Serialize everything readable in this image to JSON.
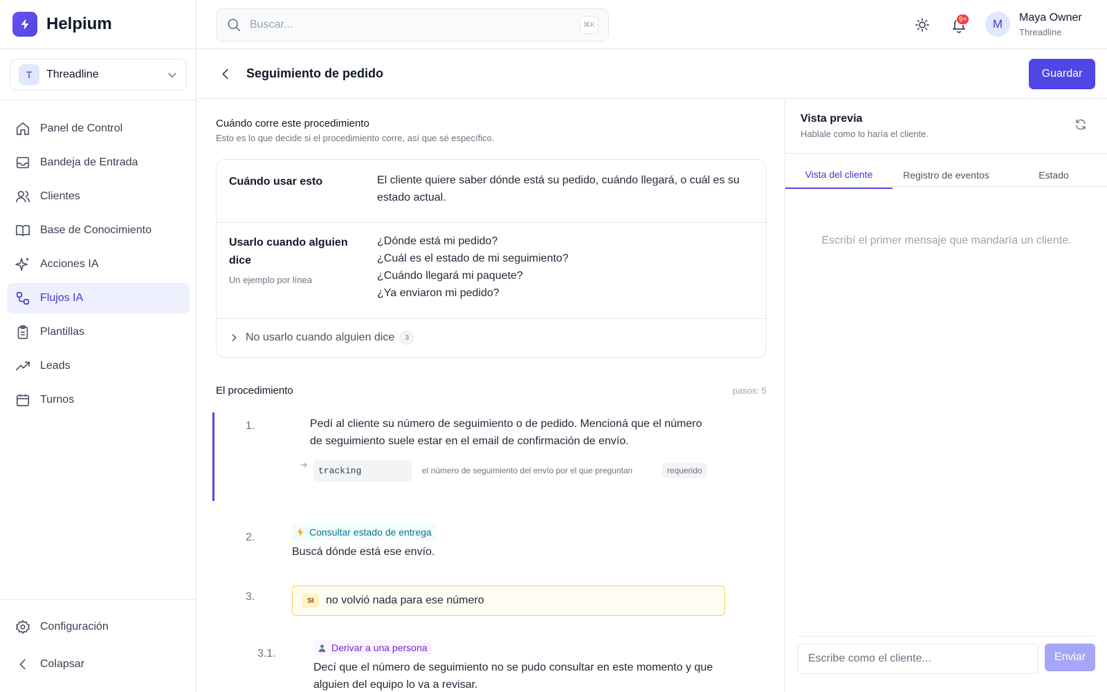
{
  "app": {
    "name": "Helpium",
    "logo_icon": "bolt-icon",
    "brand_color": "#4f46e5"
  },
  "workspace": {
    "initial": "T",
    "name": "Threadline"
  },
  "nav": {
    "items": [
      {
        "label": "Panel de Control",
        "icon": "home-icon"
      },
      {
        "label": "Bandeja de Entrada",
        "icon": "inbox-icon"
      },
      {
        "label": "Clientes",
        "icon": "users-icon"
      },
      {
        "label": "Base de Conocimiento",
        "icon": "book-icon"
      },
      {
        "label": "Acciones IA",
        "icon": "sparkle-icon"
      },
      {
        "label": "Flujos IA",
        "icon": "flow-icon",
        "active": true
      },
      {
        "label": "Plantillas",
        "icon": "clipboard-icon"
      },
      {
        "label": "Leads",
        "icon": "trending-up-icon"
      },
      {
        "label": "Turnos",
        "icon": "calendar-icon"
      }
    ],
    "settings": "Configuración",
    "collapse": "Colapsar"
  },
  "search": {
    "placeholder": "Buscar...",
    "shortcut": "⌘K"
  },
  "header": {
    "notifications_badge": "9+"
  },
  "user": {
    "initial": "M",
    "name": "Maya Owner",
    "org": "Threadline"
  },
  "page": {
    "title": "Seguimiento de pedido",
    "save_label": "Guardar"
  },
  "trigger": {
    "title": "Cuándo corre este procedimiento",
    "subtitle": "Esto es lo que decide si el procedimiento corre, así que sé específico.",
    "when_label": "Cuándo usar esto",
    "when_value": "El cliente quiere saber dónde está su pedido, cuándo llegará, o cuál es su estado actual.",
    "says_label_1": "Usarlo cuando alguien",
    "says_label_2": "dice",
    "says_hint": "Un ejemplo por línea",
    "examples": [
      "¿Dónde está mi pedido?",
      "¿Cuál es el estado de mi seguimiento?",
      "¿Cuándo llegará mi paquete?",
      "¿Ya enviaron mi pedido?"
    ],
    "not_label": "No usarlo cuando alguien dice",
    "not_count": "3"
  },
  "procedure": {
    "title": "El procedimiento",
    "steps_count": "pasos: 5",
    "step1": {
      "num": "1.",
      "text_1": "Pedí al cliente su número de seguimiento o de pedido. Mencioná que el número",
      "text_2": "de seguimiento suele estar en el email de confirmación de envío.",
      "var_name": "tracking",
      "var_desc": "el número de seguimiento del envío por el que preguntan",
      "var_required": "requerido"
    },
    "step2": {
      "num": "2.",
      "action": "Consultar estado de entrega",
      "text": "Buscá dónde está ese envío."
    },
    "step3": {
      "num": "3.",
      "condition_tag": "SI",
      "condition": "no volvió nada para ese número"
    },
    "step31": {
      "num": "3.1.",
      "action": "Derivar a una persona",
      "text_1": "Decí que el número de seguimiento no se pudo consultar en este momento y que",
      "text_2": "alguien del equipo lo va a revisar."
    }
  },
  "preview": {
    "title": "Vista previa",
    "subtitle": "Hablale como lo haría el cliente.",
    "tabs": [
      "Vista del cliente",
      "Registro de eventos",
      "Estado"
    ],
    "empty": "Escribí el primer mensaje que mandaría un cliente.",
    "input_placeholder": "Escribe como el cliente...",
    "send": "Enviar"
  }
}
